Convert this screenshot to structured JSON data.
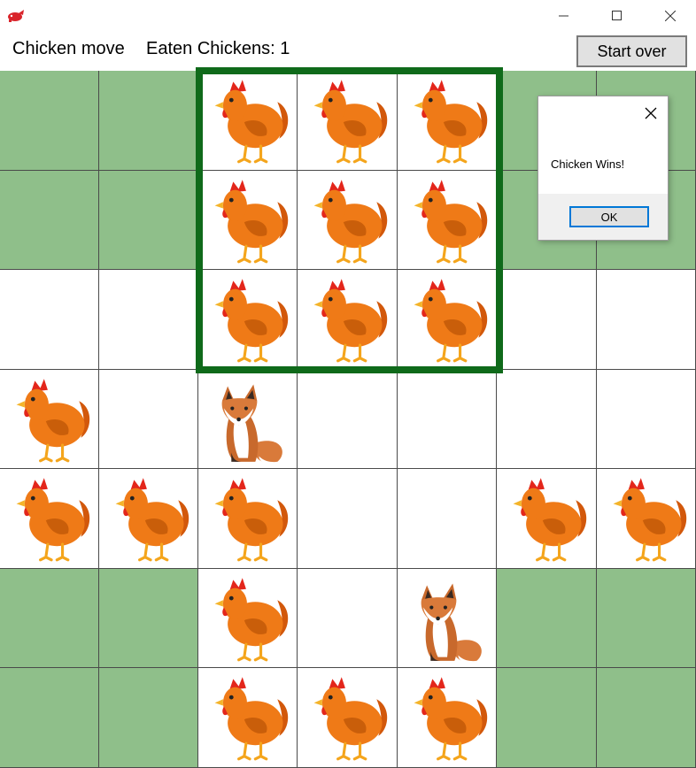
{
  "window": {
    "minimize_icon": "minimize-icon",
    "maximize_icon": "maximize-icon",
    "close_icon": "close-icon"
  },
  "status": {
    "turn": "Chicken move",
    "eaten": "Eaten Chickens: 1"
  },
  "toolbar": {
    "start_over": "Start over"
  },
  "dialog": {
    "message": "Chicken Wins!",
    "ok": "OK"
  },
  "colors": {
    "board_green": "#8fbf8a",
    "highlight": "#0f6a1a",
    "accent": "#0078d7"
  },
  "board": {
    "rows": 7,
    "cols": 7,
    "cells": [
      [
        "green",
        "green",
        "chicken",
        "chicken",
        "chicken",
        "green",
        "green"
      ],
      [
        "green",
        "green",
        "chicken",
        "chicken",
        "chicken",
        "green",
        "green"
      ],
      [
        "white",
        "white",
        "chicken",
        "chicken",
        "chicken",
        "white",
        "white"
      ],
      [
        "chicken",
        "white",
        "fox",
        "white",
        "white",
        "white",
        "white"
      ],
      [
        "chicken",
        "chicken",
        "chicken",
        "white",
        "white",
        "chicken",
        "chicken"
      ],
      [
        "green",
        "green",
        "chicken",
        "white",
        "fox",
        "green",
        "green"
      ],
      [
        "green",
        "green",
        "chicken",
        "chicken",
        "chicken",
        "green",
        "green"
      ]
    ]
  }
}
